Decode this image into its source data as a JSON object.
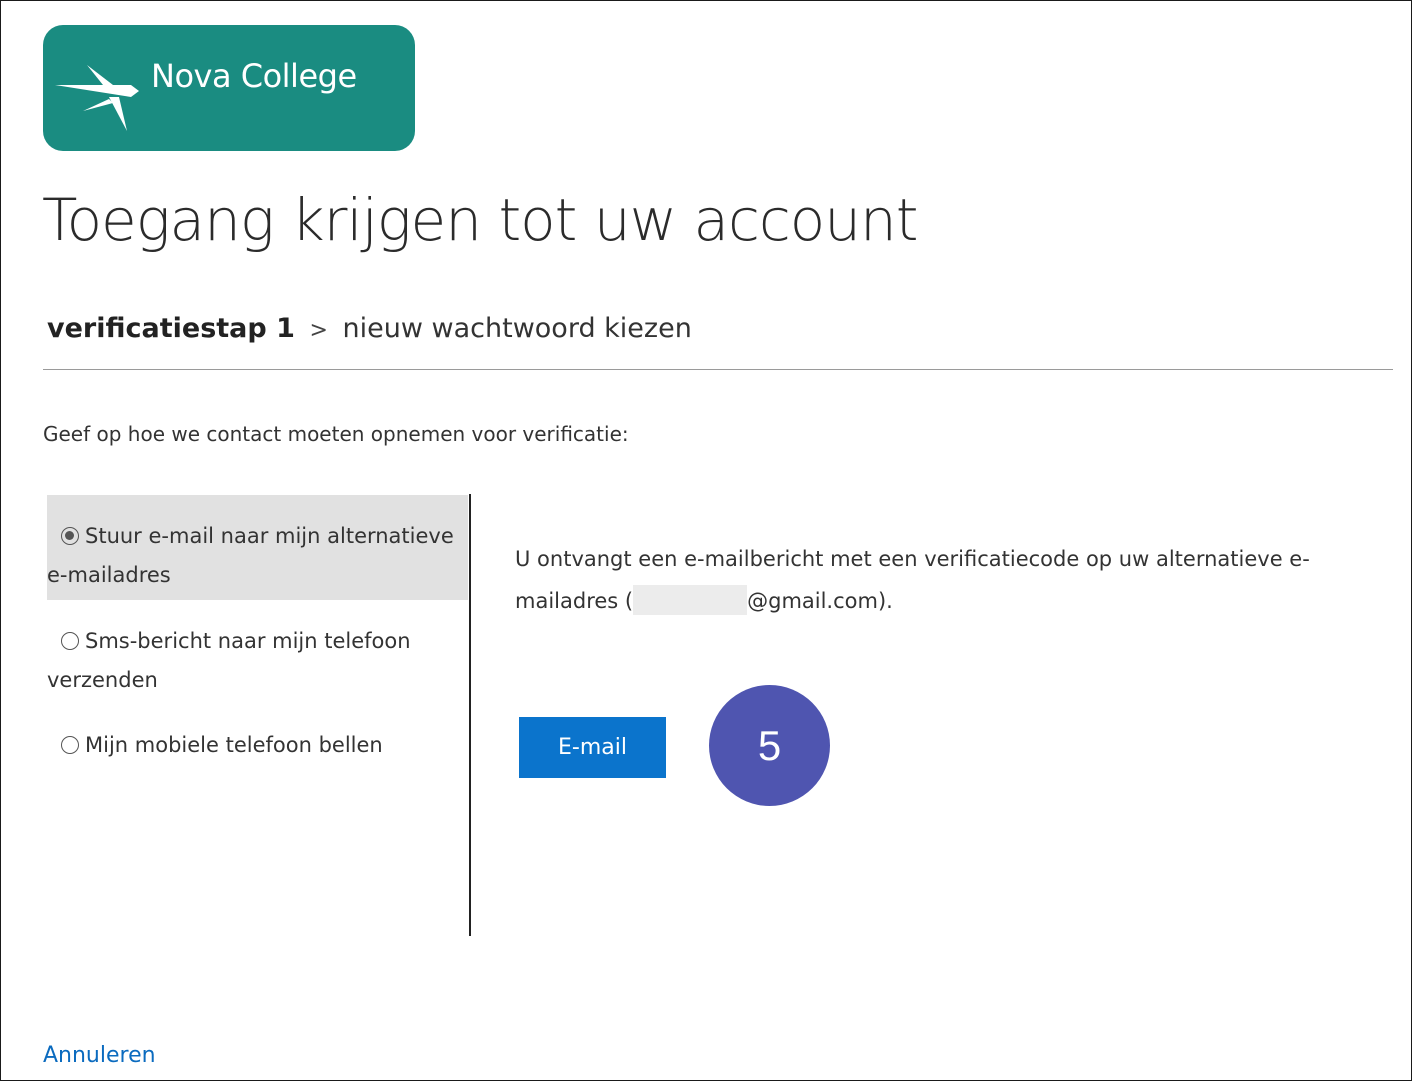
{
  "logo": {
    "text": "Nova College",
    "bg_color": "#1a8c81"
  },
  "page_title": "Toegang krijgen tot uw account",
  "breadcrumb": {
    "current_step": "verificatiestap 1",
    "separator": ">",
    "next_step": "nieuw wachtwoord kiezen"
  },
  "instruction": "Geef op hoe we contact moeten opnemen voor verificatie:",
  "options": [
    {
      "label": "Stuur e-mail naar mijn alternatieve e-mailadres",
      "selected": true
    },
    {
      "label": "Sms-bericht naar mijn telefoon verzenden",
      "selected": false
    },
    {
      "label": "Mijn mobiele telefoon bellen",
      "selected": false
    }
  ],
  "detail": {
    "text_before": "U ontvangt een e-mailbericht met een verificatiecode op uw alternatieve e-mailadres (",
    "email_domain": "@gmail.com).",
    "email_local_masked": true
  },
  "email_button_label": "E-mail",
  "step_badge": "5",
  "cancel_label": "Annuleren",
  "colors": {
    "accent_button": "#0b74cc",
    "link": "#0b6bbf",
    "badge": "#4f55b0",
    "selected_option_bg": "#e1e1e1"
  }
}
